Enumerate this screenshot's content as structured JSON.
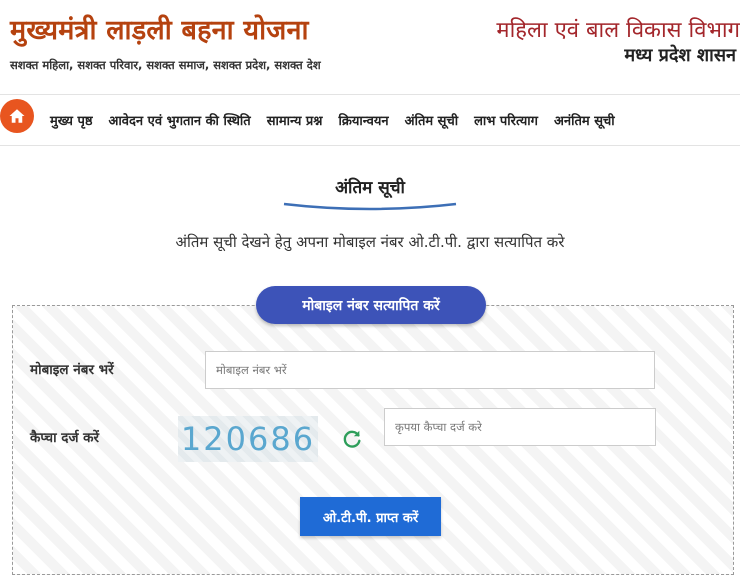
{
  "header": {
    "site_title": "मुख्यमंत्री लाड़ली बहना योजना",
    "tagline": "सशक्त महिला, सशक्त परिवार, सशक्त समाज, सशक्त प्रदेश, सशक्त देश",
    "department": "महिला एवं बाल विकास विभाग",
    "government": "मध्य प्रदेश शासन"
  },
  "nav": {
    "items": [
      "मुख्य पृष्ठ",
      "आवेदन एवं भुगतान की स्थिति",
      "सामान्य प्रश्न",
      "क्रियान्वयन",
      "अंतिम सूची",
      "लाभ परित्याग",
      "अनंतिम सूची"
    ]
  },
  "page": {
    "heading": "अंतिम सूची",
    "instruction": "अंतिम सूची देखने हेतु अपना मोबाइल नंबर ओ.टी.पी. द्वारा सत्यापित करे"
  },
  "form": {
    "badge": "मोबाइल नंबर सत्यापित करें",
    "mobile_label": "मोबाइल नंबर भरें",
    "mobile_placeholder": "मोबाइल नंबर भरें",
    "captcha_label": "कैप्चा दर्ज करें",
    "captcha_code": "120686",
    "captcha_placeholder": "कृपया कैप्चा दर्ज करे",
    "otp_button": "ओ.टी.पी. प्राप्त करें"
  },
  "colors": {
    "title": "#b5420f",
    "department": "#a3262b",
    "accent_orange": "#e8551f",
    "badge": "#3d53b8",
    "button": "#1f6bd6",
    "captcha": "#5aa7cf",
    "refresh": "#2e9e5a"
  },
  "icons": {
    "home": "home-icon",
    "refresh": "refresh-icon"
  }
}
